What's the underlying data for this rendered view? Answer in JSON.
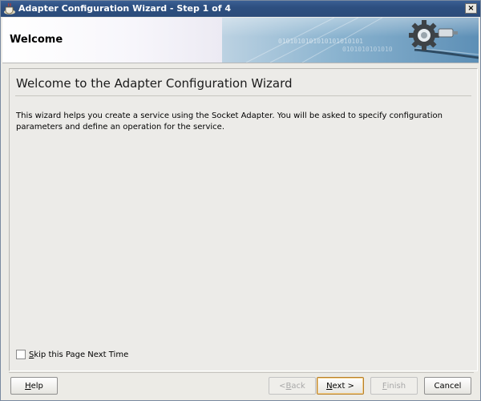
{
  "window": {
    "title": "Adapter Configuration Wizard - Step 1 of 4",
    "close_label": "×"
  },
  "header": {
    "title": "Welcome",
    "banner_text": "0101010101010101010101",
    "banner_text2": "0101010101010"
  },
  "content": {
    "heading": "Welcome to the Adapter Configuration Wizard",
    "description": "This wizard helps you create a service using the Socket Adapter. You will be asked to specify configuration parameters and define an operation for the service.",
    "skip_checkbox": {
      "label_rest": "kip this Page Next Time",
      "mnemonic": "S",
      "checked": false
    }
  },
  "buttons": {
    "help": {
      "mnemonic": "H",
      "rest": "elp"
    },
    "back": {
      "prefix": "< ",
      "mnemonic": "B",
      "rest": "ack",
      "enabled": false
    },
    "next": {
      "mnemonic": "N",
      "rest": "ext >",
      "enabled": true
    },
    "finish": {
      "mnemonic": "F",
      "rest": "inish",
      "enabled": false
    },
    "cancel": {
      "label": "Cancel"
    }
  },
  "colors": {
    "titlebar": "#2d4f80",
    "banner_blue": "#6e9cc0",
    "default_button_border": "#b77f2a"
  }
}
